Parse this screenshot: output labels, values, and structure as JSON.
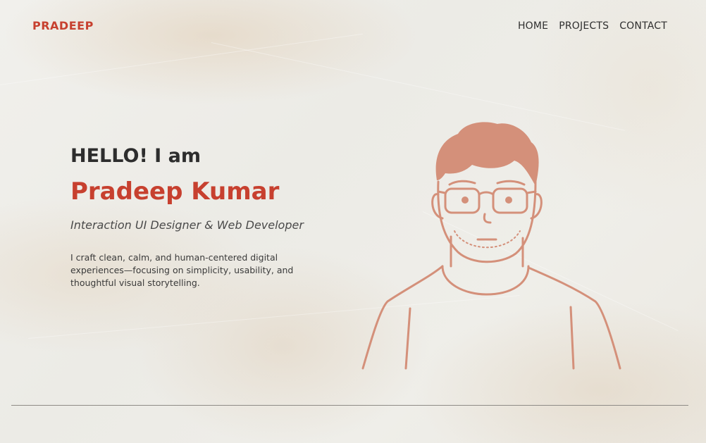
{
  "header": {
    "brand": "PRADEEP",
    "nav": [
      "HOME",
      "PROJECTS",
      "CONTACT"
    ]
  },
  "hero": {
    "greeting": "HELLO! I am",
    "name": "Pradeep Kumar",
    "role": "Interaction UI Designer & Web Developer",
    "description": "I craft clean, calm, and human-centered digital experiences—focusing on simplicity, usability, and thoughtful visual storytelling."
  },
  "colors": {
    "accent": "#c7402f",
    "text": "#2d2d2d",
    "illustration": "#d4907a",
    "background": "#efede8"
  },
  "illustration": {
    "icon": "avatar-illustration"
  }
}
